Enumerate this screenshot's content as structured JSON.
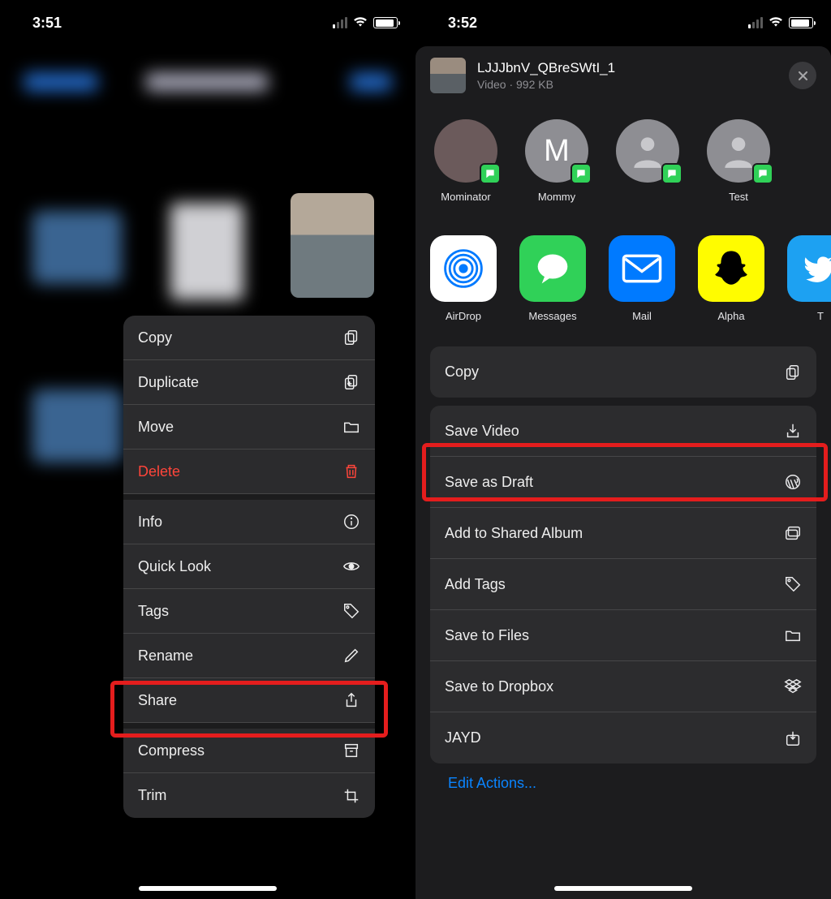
{
  "left": {
    "time": "3:51",
    "menu": [
      {
        "label": "Copy",
        "icon": "copy"
      },
      {
        "label": "Duplicate",
        "icon": "duplicate"
      },
      {
        "label": "Move",
        "icon": "folder"
      },
      {
        "label": "Delete",
        "icon": "trash",
        "destructive": true
      },
      {
        "label": "Info",
        "icon": "info",
        "gap": true
      },
      {
        "label": "Quick Look",
        "icon": "eye"
      },
      {
        "label": "Tags",
        "icon": "tag"
      },
      {
        "label": "Rename",
        "icon": "pencil"
      },
      {
        "label": "Share",
        "icon": "share",
        "highlight": true
      },
      {
        "label": "Compress",
        "icon": "archive",
        "gap": true
      },
      {
        "label": "Trim",
        "icon": "crop"
      }
    ]
  },
  "right": {
    "time": "3:52",
    "file": {
      "name": "LJJJbnV_QBreSWtI_1",
      "meta": "Video · 992 KB"
    },
    "contacts": [
      {
        "name": "Mominator",
        "type": "photo"
      },
      {
        "name": "Mommy",
        "type": "initial",
        "initial": "M"
      },
      {
        "name": "",
        "type": "placeholder"
      },
      {
        "name": "Test",
        "type": "placeholder"
      }
    ],
    "apps": [
      {
        "label": "AirDrop",
        "kind": "airdrop"
      },
      {
        "label": "Messages",
        "kind": "messages"
      },
      {
        "label": "Mail",
        "kind": "mail"
      },
      {
        "label": "Alpha",
        "kind": "snap"
      },
      {
        "label": "T",
        "kind": "twitter"
      }
    ],
    "actions_group1": [
      {
        "label": "Copy",
        "icon": "copy"
      }
    ],
    "actions_group2": [
      {
        "label": "Save Video",
        "icon": "download",
        "highlight": true
      },
      {
        "label": "Save as Draft",
        "icon": "wordpress"
      },
      {
        "label": "Add to Shared Album",
        "icon": "album"
      },
      {
        "label": "Add Tags",
        "icon": "tag"
      },
      {
        "label": "Save to Files",
        "icon": "folder"
      },
      {
        "label": "Save to Dropbox",
        "icon": "dropbox"
      },
      {
        "label": "JAYD",
        "icon": "download-box"
      }
    ],
    "edit_actions": "Edit Actions..."
  }
}
